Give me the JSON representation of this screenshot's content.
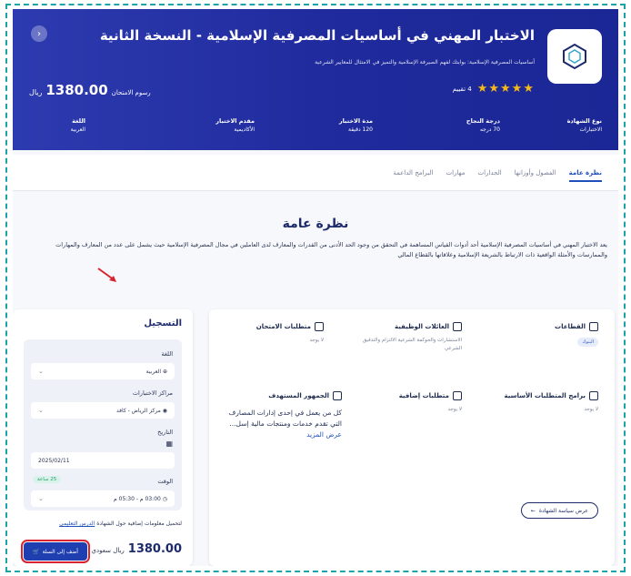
{
  "hero": {
    "title": "الاختبار المهني في أساسيات المصرفية الإسلامية - النسخة الثانية",
    "subtitle": "أساسيات المصرفية الإسلامية: بوابتك لفهم الصيرفة الإسلامية والتميز في الامتثال للمعايير الشرعية",
    "rating_count": "4 تقييم",
    "stars": "★★★★★",
    "price_label": "رسوم الامتحان",
    "price_amount": "1380.00",
    "price_currency": "ريال",
    "back_icon": "chevron-left-icon",
    "stats": [
      {
        "label": "نوع الشهادة",
        "value": "الاختبارات"
      },
      {
        "label": "درجة النجاح",
        "value": "70 درجه"
      },
      {
        "label": "مدة الاختبار",
        "value": "120 دقيقة"
      },
      {
        "label": "مقدم الاختبار",
        "value": "الأكاديمية"
      },
      {
        "label": "اللغة",
        "value": "العربية"
      }
    ]
  },
  "tabs": [
    "نظرة عامة",
    "الفصول وأوزانها",
    "الجدارات",
    "مهارات",
    "البرامج الداعمة"
  ],
  "overview": {
    "title": "نظرة عامة",
    "text": "يعد الاختبار المهني في أساسيات المصرفية الإسلامية أحد أدوات القياس المساهمة في التحقق من وجود الحد الأدنى من القدرات والمعارف لدى العاملين في مجال المصرفية الإسلامية حيث يشمل على عدد من المعارف والمهارات والممارسات والأمثلة الواقعية ذات الارتباط بالشريعة الإسلامية وعلاقاتها بالقطاع المالي"
  },
  "registration": {
    "title": "التسجيل",
    "language_label": "اللغة",
    "language_value": "العربية",
    "centers_label": "مراكز الاختبارات",
    "centers_value": "مركز الرياض - كافد",
    "date_label": "التاريخ",
    "date_value": "2025/02/11",
    "time_label": "الوقت",
    "time_value": "03:00 م - 05:30 م",
    "hours_badge": "25 ساعة",
    "note_prefix": "لتحميل معلومات إضافية حول الشهادة",
    "note_link": "الدرس التعليمي",
    "price": "1380.00",
    "currency": "ريال سعودي",
    "cart_button": "أضف إلى السلة"
  },
  "info": {
    "sectors_title": "القطاعات",
    "sectors_chip": "البنوك",
    "jobs_title": "العائلات الوظيفية",
    "jobs_text": "الاستشارات والحوكمة الشرعية الالتزام والتدقيق الشرعي",
    "exam_req_title": "متطلبات الامتحان",
    "exam_req_value": "لا يوجد",
    "basic_req_title": "برامج المتطلبات الأساسية",
    "basic_req_value": "لا يوجد",
    "extra_req_title": "متطلبات إضافية",
    "extra_req_value": "لا يوجد",
    "audience_title": "الجمهور المستهدف",
    "audience_text": "كل من يعمل في إحدى إدارات المصارف التي تقدم خدمات ومنتجات مالية إسل...",
    "audience_more": "عرض المزيد",
    "policy_button": "عرض سياسة الشهادة"
  },
  "colors": {
    "brand": "#1f2a9c",
    "accent": "#1f4fb8",
    "star": "#f5b917",
    "highlight": "#d9232d"
  }
}
